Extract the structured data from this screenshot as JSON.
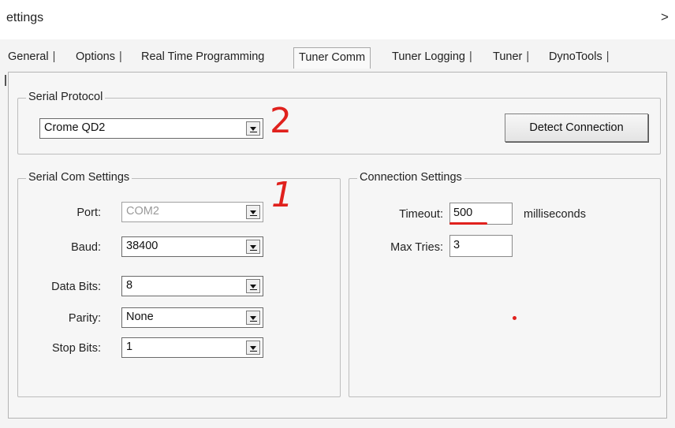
{
  "window": {
    "title": "ettings",
    "close_glyph": ">"
  },
  "tabs": [
    {
      "label": "General"
    },
    {
      "label": "Options"
    },
    {
      "label": "Real Time Programming"
    },
    {
      "label": "Tuner Comm"
    },
    {
      "label": "Tuner Logging"
    },
    {
      "label": "Tuner"
    },
    {
      "label": "DynoTools"
    }
  ],
  "active_tab": "Tuner Comm",
  "serial_protocol": {
    "group_title": "Serial Protocol",
    "selected": "Crome QD2",
    "detect_button": "Detect Connection"
  },
  "serial_com": {
    "group_title": "Serial Com Settings",
    "port": {
      "label": "Port:",
      "value": "COM2",
      "enabled": false
    },
    "baud": {
      "label": "Baud:",
      "value": "38400"
    },
    "data_bits": {
      "label": "Data Bits:",
      "value": "8"
    },
    "parity": {
      "label": "Parity:",
      "value": "None"
    },
    "stop_bits": {
      "label": "Stop Bits:",
      "value": "1"
    }
  },
  "connection": {
    "group_title": "Connection Settings",
    "timeout": {
      "label": "Timeout:",
      "value": "500",
      "unit": "milliseconds"
    },
    "max_tries": {
      "label": "Max Tries:",
      "value": "3"
    }
  },
  "annotations": {
    "mark_1": "1",
    "mark_2": "2"
  },
  "colors": {
    "annotation": "#e0211d"
  }
}
